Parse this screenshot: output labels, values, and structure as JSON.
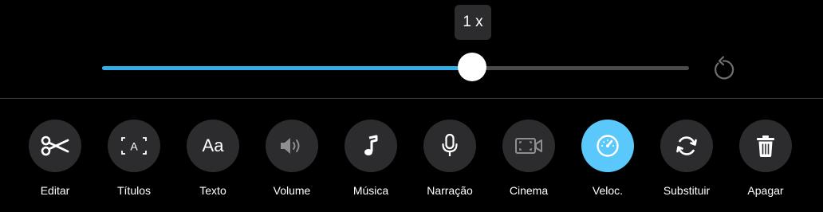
{
  "speed": {
    "tooltip": "1 x",
    "slider_fraction": 0.63,
    "reset_icon": "reset-icon"
  },
  "colors": {
    "background": "#000000",
    "accent": "#32ade6",
    "active_button": "#5ac8fa",
    "button": "#2c2c2e"
  },
  "toolbar": {
    "items": [
      {
        "label": "Editar",
        "icon": "scissors-icon"
      },
      {
        "label": "Títulos",
        "icon": "titles-icon",
        "glyph": "A"
      },
      {
        "label": "Texto",
        "icon": "text-icon",
        "glyph": "Aa"
      },
      {
        "label": "Volume",
        "icon": "speaker-icon"
      },
      {
        "label": "Música",
        "icon": "music-note-icon"
      },
      {
        "label": "Narração",
        "icon": "microphone-icon"
      },
      {
        "label": "Cinema",
        "icon": "cinema-icon"
      },
      {
        "label": "Veloc.",
        "icon": "speedometer-icon",
        "active": true
      },
      {
        "label": "Substituir",
        "icon": "replace-icon"
      },
      {
        "label": "Apagar",
        "icon": "trash-icon"
      }
    ]
  }
}
